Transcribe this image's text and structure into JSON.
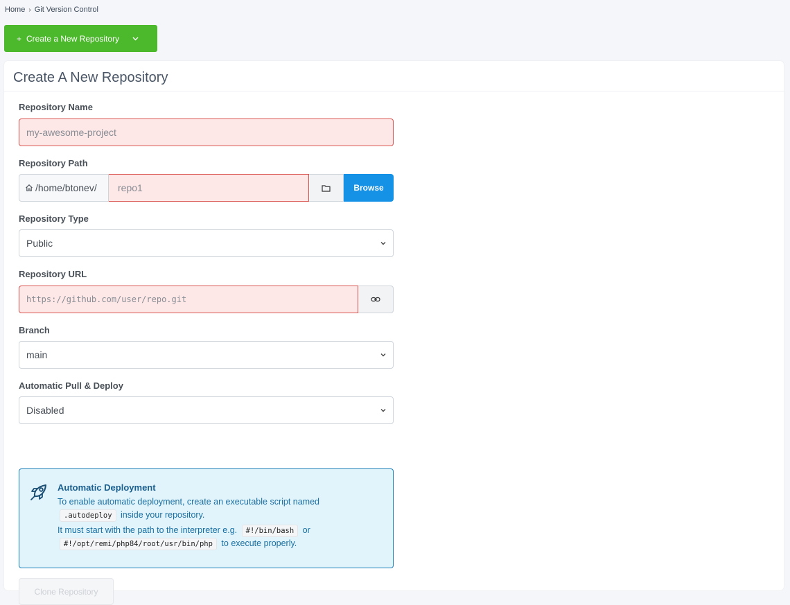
{
  "breadcrumb": {
    "home": "Home",
    "separator": "›",
    "current": "Git Version Control"
  },
  "create_button": {
    "icon": "+",
    "label": "Create a New Repository",
    "chevron": "⌄"
  },
  "card": {
    "title": "Create A New Repository"
  },
  "repo_name": {
    "label": "Repository Name",
    "placeholder": "my-awesome-project"
  },
  "repo_path": {
    "label": "Repository Path",
    "prefix": "/home/btonev/",
    "placeholder": "repo1",
    "browse_label": "Browse"
  },
  "repo_type": {
    "label": "Repository Type",
    "selected": "Public"
  },
  "repo_url": {
    "label": "Repository URL",
    "placeholder": "https://github.com/user/repo.git"
  },
  "branch": {
    "label": "Branch",
    "selected": "main"
  },
  "auto_deploy": {
    "label": "Automatic Pull & Deploy",
    "selected": "Disabled"
  },
  "info": {
    "title": "Automatic Deployment",
    "line1_text": "To enable automatic deployment, create an executable script named",
    "line1_code": ".autodeploy",
    "line1_suffix": "inside your repository.",
    "line2_text": "It must start with the path to the interpreter e.g.",
    "line2_code1": "#!/bin/bash",
    "line2_or": "or",
    "line2_code2": "#!/opt/remi/php84/root/usr/bin/php",
    "line2_suffix": "to execute properly."
  },
  "clone_button": {
    "label": "Clone Repository"
  },
  "colors": {
    "primary_green": "#4cb82c",
    "browse_blue": "#1592e6",
    "error_bg": "#fde7e7",
    "error_border": "#d9534f",
    "info_bg": "#e1f3fb",
    "info_border": "#1c7fb8"
  }
}
